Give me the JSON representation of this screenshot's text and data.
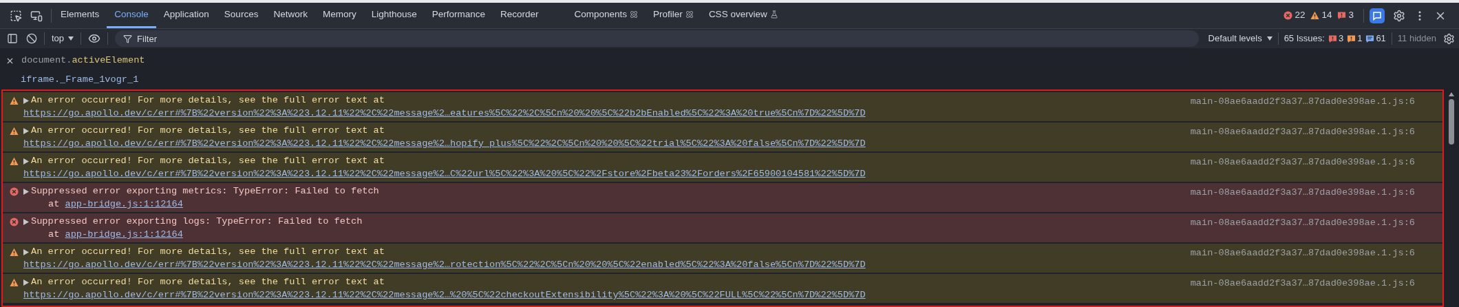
{
  "tabs": [
    {
      "label": "Elements",
      "selected": false,
      "kind": "plain"
    },
    {
      "label": "Console",
      "selected": true,
      "kind": "plain"
    },
    {
      "label": "Application",
      "selected": false,
      "kind": "plain"
    },
    {
      "label": "Sources",
      "selected": false,
      "kind": "plain"
    },
    {
      "label": "Network",
      "selected": false,
      "kind": "plain"
    },
    {
      "label": "Memory",
      "selected": false,
      "kind": "plain"
    },
    {
      "label": "Lighthouse",
      "selected": false,
      "kind": "plain"
    },
    {
      "label": "Performance",
      "selected": false,
      "kind": "plain"
    },
    {
      "label": "Recorder",
      "selected": false,
      "kind": "plain"
    },
    {
      "label": "Components",
      "selected": false,
      "kind": "react"
    },
    {
      "label": "Profiler",
      "selected": false,
      "kind": "react"
    },
    {
      "label": "CSS overview",
      "selected": false,
      "kind": "experiment"
    }
  ],
  "counters": [
    {
      "kind": "error",
      "count": "22"
    },
    {
      "kind": "warning",
      "count": "14"
    },
    {
      "kind": "issue",
      "count": "3"
    }
  ],
  "toolbar": {
    "context": "top",
    "filter_placeholder": "Filter",
    "levels": "Default levels",
    "issues_label": "65 Issues:",
    "issues": [
      {
        "kind": "error",
        "count": "3"
      },
      {
        "kind": "warning",
        "count": "1"
      },
      {
        "kind": "info",
        "count": "61"
      }
    ],
    "hidden": "11 hidden"
  },
  "expression": {
    "object": "document.",
    "property": "activeElement"
  },
  "result": "iframe._Frame_1vogr_1",
  "messages": [
    {
      "kind": "warning",
      "expanded": false,
      "text": "An error occurred! For more details, see the full error text at",
      "link": "https://go.apollo.dev/c/err#%7B%22version%22%3A%223.12.11%22%2C%22message%2…eatures%5C%22%2C%5Cn%20%20%5C%22b2bEnabled%5C%22%3A%20true%5Cn%7D%22%5D%7D",
      "source": "main-08ae6aadd2f3a37…87dad0e398ae.1.js:6"
    },
    {
      "kind": "warning",
      "expanded": false,
      "text": "An error occurred! For more details, see the full error text at",
      "link": "https://go.apollo.dev/c/err#%7B%22version%22%3A%223.12.11%22%2C%22message%2…hopify_plus%5C%22%2C%5Cn%20%20%5C%22trial%5C%22%3A%20false%5Cn%7D%22%5D%7D",
      "source": "main-08ae6aadd2f3a37…87dad0e398ae.1.js:6"
    },
    {
      "kind": "warning",
      "expanded": false,
      "text": "An error occurred! For more details, see the full error text at",
      "link": "https://go.apollo.dev/c/err#%7B%22version%22%3A%223.12.11%22%2C%22message%2…C%22url%5C%22%3A%20%5C%22%2Fstore%2Fbeta23%2Forders%2F65900104581%22%5D%7D",
      "source": "main-08ae6aadd2f3a37…87dad0e398ae.1.js:6"
    },
    {
      "kind": "error",
      "expanded": false,
      "text": "Suppressed error exporting metrics: TypeError: Failed to fetch",
      "link_prefix": "at",
      "link": "app-bridge.js:1:12164",
      "source": "main-08ae6aadd2f3a37…87dad0e398ae.1.js:6"
    },
    {
      "kind": "error",
      "expanded": false,
      "text": "Suppressed error exporting logs: TypeError: Failed to fetch",
      "link_prefix": "at",
      "link": "app-bridge.js:1:12164",
      "source": "main-08ae6aadd2f3a37…87dad0e398ae.1.js:6"
    },
    {
      "kind": "warning",
      "expanded": false,
      "text": "An error occurred! For more details, see the full error text at",
      "link": "https://go.apollo.dev/c/err#%7B%22version%22%3A%223.12.11%22%2C%22message%2…rotection%5C%22%2C%5Cn%20%20%5C%22enabled%5C%22%3A%20false%5Cn%7D%22%5D%7D",
      "source": "main-08ae6aadd2f3a37…87dad0e398ae.1.js:6"
    },
    {
      "kind": "warning",
      "expanded": false,
      "text": "An error occurred! For more details, see the full error text at",
      "link": "https://go.apollo.dev/c/err#%7B%22version%22%3A%223.12.11%22%2C%22message%2…%20%5C%22checkoutExtensibility%5C%22%3A%20%5C%22FULL%5C%22%5Cn%7D%22%5D%7D",
      "source": "main-08ae6aadd2f3a37…87dad0e398ae.1.js:6"
    }
  ]
}
